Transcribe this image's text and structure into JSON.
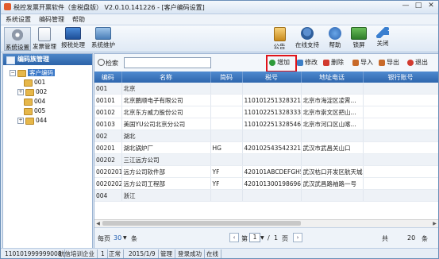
{
  "window": {
    "title": "税控发票开票软件（金税盘版） V2.0.10.141226 - [客户编码设置]",
    "controls": [
      "—",
      "□",
      "✕"
    ]
  },
  "menu": [
    "系统设置",
    "编码管理",
    "帮助"
  ],
  "toolbar": {
    "left": [
      {
        "label": "系统设置",
        "icon": "gear-icon"
      },
      {
        "label": "发票管理",
        "icon": "invoice-icon"
      },
      {
        "label": "报税处理",
        "icon": "monitor-icon"
      },
      {
        "label": "系统维护",
        "icon": "maintenance-icon"
      }
    ],
    "right": [
      {
        "label": "公告",
        "icon": "notice-icon"
      },
      {
        "label": "在线支持",
        "icon": "support-icon"
      },
      {
        "label": "帮助",
        "icon": "help-icon"
      },
      {
        "label": "锁屏",
        "icon": "lock-screen-icon"
      },
      {
        "label": "关闭",
        "icon": "close-arrow-icon"
      }
    ]
  },
  "left_panel": {
    "title": "编码族管理",
    "tree": [
      {
        "label": "客户编码",
        "level": 0,
        "expanded": true,
        "selected": true
      },
      {
        "label": "001",
        "level": 1,
        "expander": ""
      },
      {
        "label": "002",
        "level": 1,
        "expander": "+"
      },
      {
        "label": "004",
        "level": 1,
        "expander": ""
      },
      {
        "label": "005",
        "level": 1,
        "expander": ""
      },
      {
        "label": "044",
        "level": 1,
        "expander": "+"
      }
    ]
  },
  "search": {
    "label": "检索",
    "value": ""
  },
  "actions": [
    {
      "label": "增加",
      "icon": "add-icon",
      "color": "#2e9b3a"
    },
    {
      "label": "修改",
      "icon": "edit-icon",
      "color": "#3d7fc6"
    },
    {
      "label": "删除",
      "icon": "delete-icon",
      "color": "#d23b2f"
    },
    {
      "label": "导入",
      "icon": "import-icon",
      "color": "#c86a2a"
    },
    {
      "label": "导出",
      "icon": "export-icon",
      "color": "#c86a2a"
    },
    {
      "label": "退出",
      "icon": "exit-icon",
      "color": "#d23b2f"
    }
  ],
  "table": {
    "columns": [
      "编码",
      "名称",
      "简码",
      "税号",
      "地址电话",
      "银行账号"
    ],
    "rows": [
      {
        "group": true,
        "cells": [
          "001",
          "北京",
          "",
          "",
          "",
          ""
        ]
      },
      {
        "group": false,
        "cells": [
          "00101",
          "北京鹏顺电子有限公司",
          "",
          "110101251328321",
          "北京市海淀区凌霄...",
          ""
        ]
      },
      {
        "group": false,
        "cells": [
          "00102",
          "北京东方威力股份公司",
          "",
          "110102251328333",
          "北京市崇文区把山...",
          ""
        ]
      },
      {
        "group": false,
        "cells": [
          "00103",
          "美国YU公司北京分公司",
          "",
          "110102251328546",
          "北京市河口区山喀...",
          ""
        ]
      },
      {
        "group": true,
        "cells": [
          "002",
          "湖北",
          "",
          "",
          "",
          ""
        ]
      },
      {
        "group": false,
        "cells": [
          "00201",
          "湖北锅炉厂",
          "HG",
          "420102543542321",
          "武汉市武昌关山口",
          ""
        ]
      },
      {
        "group": true,
        "cells": [
          "00202",
          "三江远方公司",
          "",
          "",
          "",
          ""
        ]
      },
      {
        "group": false,
        "cells": [
          "0020201",
          "远方公司软件部",
          "YF",
          "420101ABCDEFGH5",
          "武汉枯口开发区航天城",
          ""
        ]
      },
      {
        "group": false,
        "cells": [
          "0020202",
          "远方公司工程部",
          "YF",
          "420101300198696",
          "武汉武昌路袖路一号",
          ""
        ]
      },
      {
        "group": true,
        "cells": [
          "004",
          "浙江",
          "",
          "",
          "",
          ""
        ]
      }
    ]
  },
  "pager": {
    "per_page_label": "每页",
    "per_page": "30",
    "per_page_unit": "条",
    "page_label": "第",
    "page": "1",
    "sep": "/",
    "total_pages": "1",
    "page_unit": "页",
    "total_label": "共",
    "total": "20",
    "total_unit": "条"
  },
  "status": [
    "110101999999008",
    "航信培训企业",
    "1",
    "正常",
    "2015/1/9",
    "管理",
    "登录成功",
    "在线"
  ]
}
